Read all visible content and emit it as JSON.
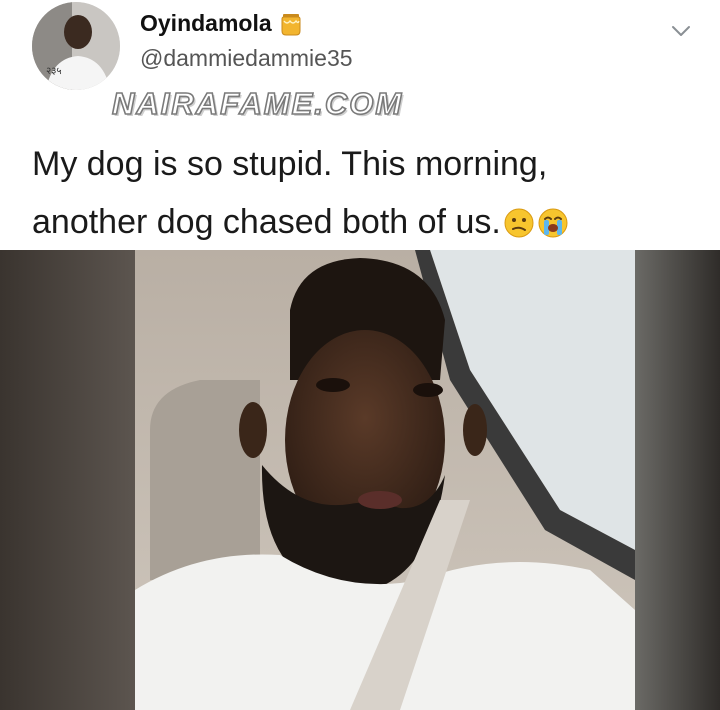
{
  "tweet": {
    "display_name": "Oyindamola",
    "handle": "@dammiedammie35",
    "text_line1": "My dog is so stupid. This morning,",
    "text_line2": "another dog chased both of us.",
    "emojis": [
      "confused-face",
      "loudly-crying-face"
    ],
    "name_badge_icon": "honey-pot-icon",
    "menu_icon": "chevron-down-icon"
  },
  "watermark": "NAIRAFAME.COM",
  "colors": {
    "name": "#111111",
    "handle": "#555555",
    "text": "#1a1a1a",
    "watermark_outline": "#7a7a7a"
  }
}
